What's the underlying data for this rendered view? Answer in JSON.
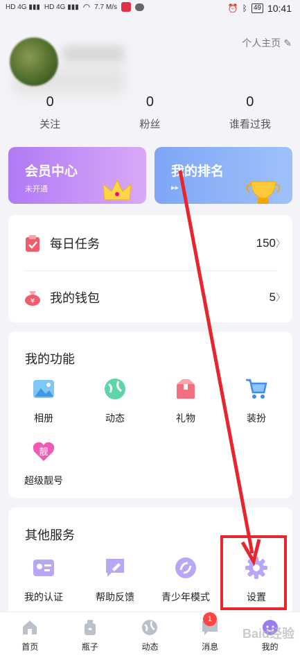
{
  "status_bar": {
    "network_speed": "7.7\nM/s",
    "battery": "49",
    "time": "10:41"
  },
  "profile": {
    "homepage_link": "个人主页"
  },
  "stats": [
    {
      "num": "0",
      "label": "关注"
    },
    {
      "num": "0",
      "label": "粉丝"
    },
    {
      "num": "0",
      "label": "谁看过我"
    }
  ],
  "cards": {
    "vip": {
      "title": "会员中心",
      "subtitle": "未开通"
    },
    "rank": {
      "title": "我的排名"
    }
  },
  "tasks": {
    "daily": {
      "label": "每日任务",
      "value": "150"
    },
    "wallet": {
      "label": "我的钱包",
      "value": "5"
    }
  },
  "features": {
    "title": "我的功能",
    "items": [
      "相册",
      "动态",
      "礼物",
      "装扮",
      "超级靓号"
    ]
  },
  "services": {
    "title": "其他服务",
    "items": [
      "我的认证",
      "帮助反馈",
      "青少年模式",
      "设置"
    ]
  },
  "tabbar": {
    "items": [
      "首页",
      "瓶子",
      "动态",
      "消息",
      "我的"
    ],
    "badge": "1"
  },
  "colors": {
    "annotation": "#e8242c",
    "accent_purple": "#9b7bf4"
  }
}
